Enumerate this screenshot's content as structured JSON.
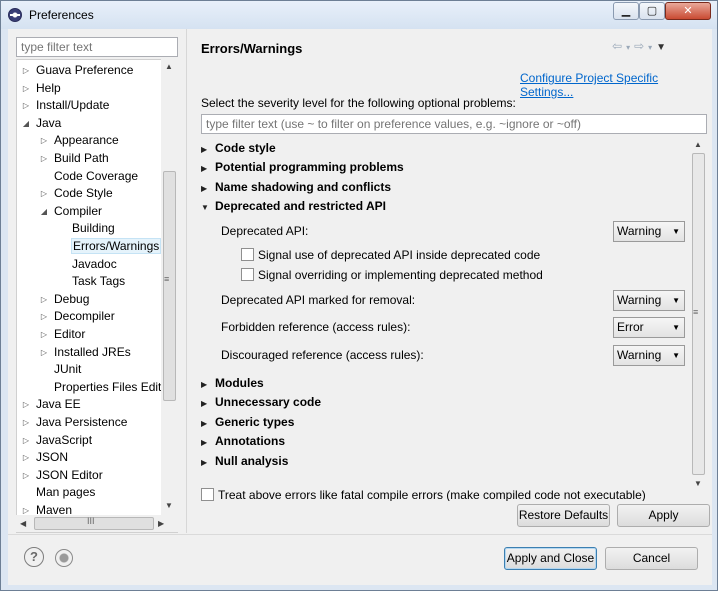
{
  "window": {
    "title": "Preferences",
    "controls": {
      "minimize": "▁",
      "maximize": "▢",
      "close": "✕"
    }
  },
  "nav": {
    "filter_placeholder": "type filter text",
    "tree": [
      {
        "label": "Guava Preference",
        "indent": 0,
        "twisty": "collapsed"
      },
      {
        "label": "Help",
        "indent": 0,
        "twisty": "collapsed"
      },
      {
        "label": "Install/Update",
        "indent": 0,
        "twisty": "collapsed"
      },
      {
        "label": "Java",
        "indent": 0,
        "twisty": "expanded"
      },
      {
        "label": "Appearance",
        "indent": 1,
        "twisty": "collapsed"
      },
      {
        "label": "Build Path",
        "indent": 1,
        "twisty": "collapsed"
      },
      {
        "label": "Code Coverage",
        "indent": 1,
        "twisty": "none"
      },
      {
        "label": "Code Style",
        "indent": 1,
        "twisty": "collapsed"
      },
      {
        "label": "Compiler",
        "indent": 1,
        "twisty": "expanded"
      },
      {
        "label": "Building",
        "indent": 2,
        "twisty": "none"
      },
      {
        "label": "Errors/Warnings",
        "indent": 2,
        "twisty": "none",
        "selected": true
      },
      {
        "label": "Javadoc",
        "indent": 2,
        "twisty": "none"
      },
      {
        "label": "Task Tags",
        "indent": 2,
        "twisty": "none"
      },
      {
        "label": "Debug",
        "indent": 1,
        "twisty": "collapsed"
      },
      {
        "label": "Decompiler",
        "indent": 1,
        "twisty": "collapsed"
      },
      {
        "label": "Editor",
        "indent": 1,
        "twisty": "collapsed"
      },
      {
        "label": "Installed JREs",
        "indent": 1,
        "twisty": "collapsed"
      },
      {
        "label": "JUnit",
        "indent": 1,
        "twisty": "none"
      },
      {
        "label": "Properties Files Editor",
        "indent": 1,
        "twisty": "none"
      },
      {
        "label": "Java EE",
        "indent": 0,
        "twisty": "collapsed"
      },
      {
        "label": "Java Persistence",
        "indent": 0,
        "twisty": "collapsed"
      },
      {
        "label": "JavaScript",
        "indent": 0,
        "twisty": "collapsed"
      },
      {
        "label": "JSON",
        "indent": 0,
        "twisty": "collapsed"
      },
      {
        "label": "JSON Editor",
        "indent": 0,
        "twisty": "collapsed"
      },
      {
        "label": "Man pages",
        "indent": 0,
        "twisty": "none"
      },
      {
        "label": "Maven",
        "indent": 0,
        "twisty": "collapsed"
      }
    ],
    "hscroll_grip": "III"
  },
  "page": {
    "title": "Errors/Warnings",
    "configure_link": "Configure Project Specific Settings...",
    "severity_label": "Select the severity level for the following optional problems:",
    "severity_filter_placeholder": "type filter text (use ~ to filter on preference values, e.g. ~ignore or ~off)",
    "sections_top": [
      {
        "label": "Code style",
        "expanded": false
      },
      {
        "label": "Potential programming problems",
        "expanded": false
      },
      {
        "label": "Name shadowing and conflicts",
        "expanded": false
      },
      {
        "label": "Deprecated and restricted API",
        "expanded": true
      }
    ],
    "deprecated": {
      "deprecated_api_label": "Deprecated API:",
      "deprecated_api_value": "Warning",
      "signal_inside_label": "Signal use of deprecated API inside deprecated code",
      "signal_inside_checked": false,
      "signal_overriding_label": "Signal overriding or implementing deprecated method",
      "signal_overriding_checked": false,
      "marked_removal_label": "Deprecated API marked for removal:",
      "marked_removal_value": "Warning",
      "forbidden_label": "Forbidden reference (access rules):",
      "forbidden_value": "Error",
      "discouraged_label": "Discouraged reference (access rules):",
      "discouraged_value": "Warning"
    },
    "sections_bottom": [
      {
        "label": "Modules",
        "expanded": false
      },
      {
        "label": "Unnecessary code",
        "expanded": false
      },
      {
        "label": "Generic types",
        "expanded": false
      },
      {
        "label": "Annotations",
        "expanded": false
      },
      {
        "label": "Null analysis",
        "expanded": false
      }
    ],
    "fatal_label": "Treat above errors like fatal compile errors (make compiled code not executable)",
    "fatal_checked": false,
    "restore_defaults": "Restore Defaults",
    "apply": "Apply"
  },
  "footer": {
    "apply_and_close": "Apply and Close",
    "cancel": "Cancel",
    "help_icon_glyph": "?"
  }
}
